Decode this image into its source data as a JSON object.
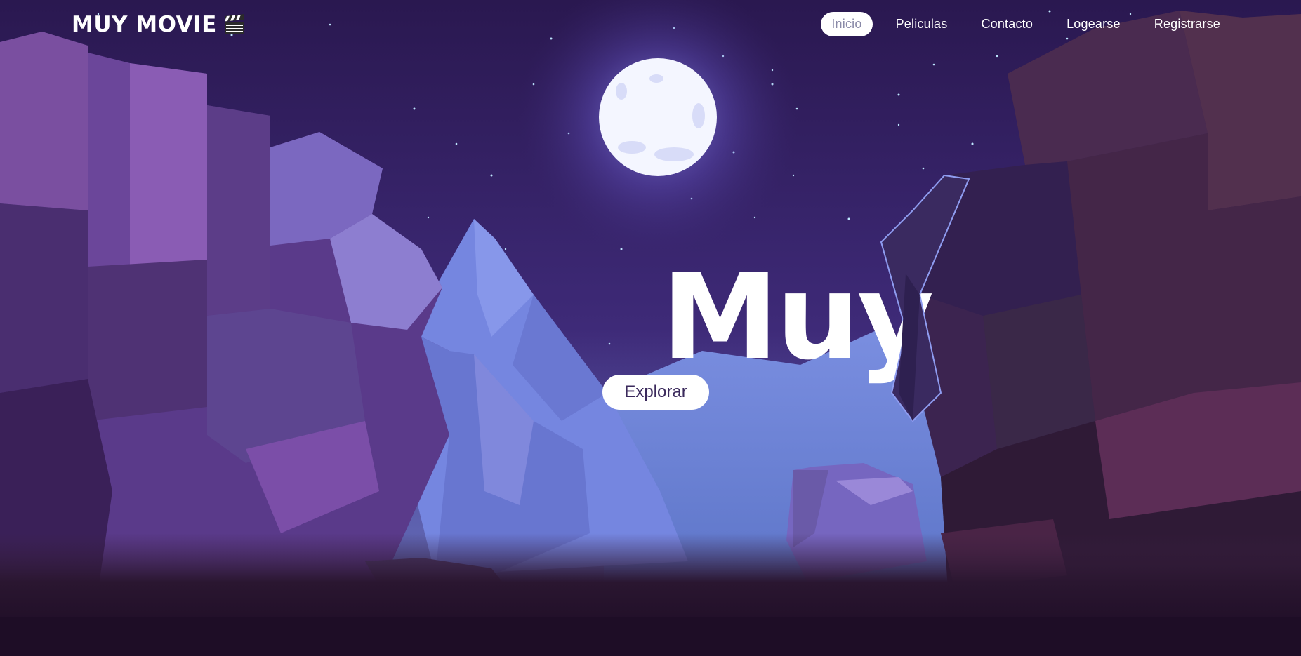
{
  "brand": {
    "name": "MUY MOVIE",
    "icon": "clapperboard-icon"
  },
  "nav": {
    "items": [
      {
        "label": "Inicio",
        "active": true
      },
      {
        "label": "Peliculas",
        "active": false
      },
      {
        "label": "Contacto",
        "active": false
      },
      {
        "label": "Logearse",
        "active": false
      },
      {
        "label": "Registrarse",
        "active": false
      }
    ]
  },
  "hero": {
    "title": "Muy",
    "button_label": "Explorar"
  },
  "colors": {
    "sky_top": "#2a1850",
    "sky_mid": "#3e2a78",
    "moon": "#f4f6ff",
    "mountain": "#6f7fd6",
    "cliff_dark": "#2c1838",
    "cliff_purple": "#5a3a8a",
    "active_nav_text": "#8a8aa8"
  }
}
